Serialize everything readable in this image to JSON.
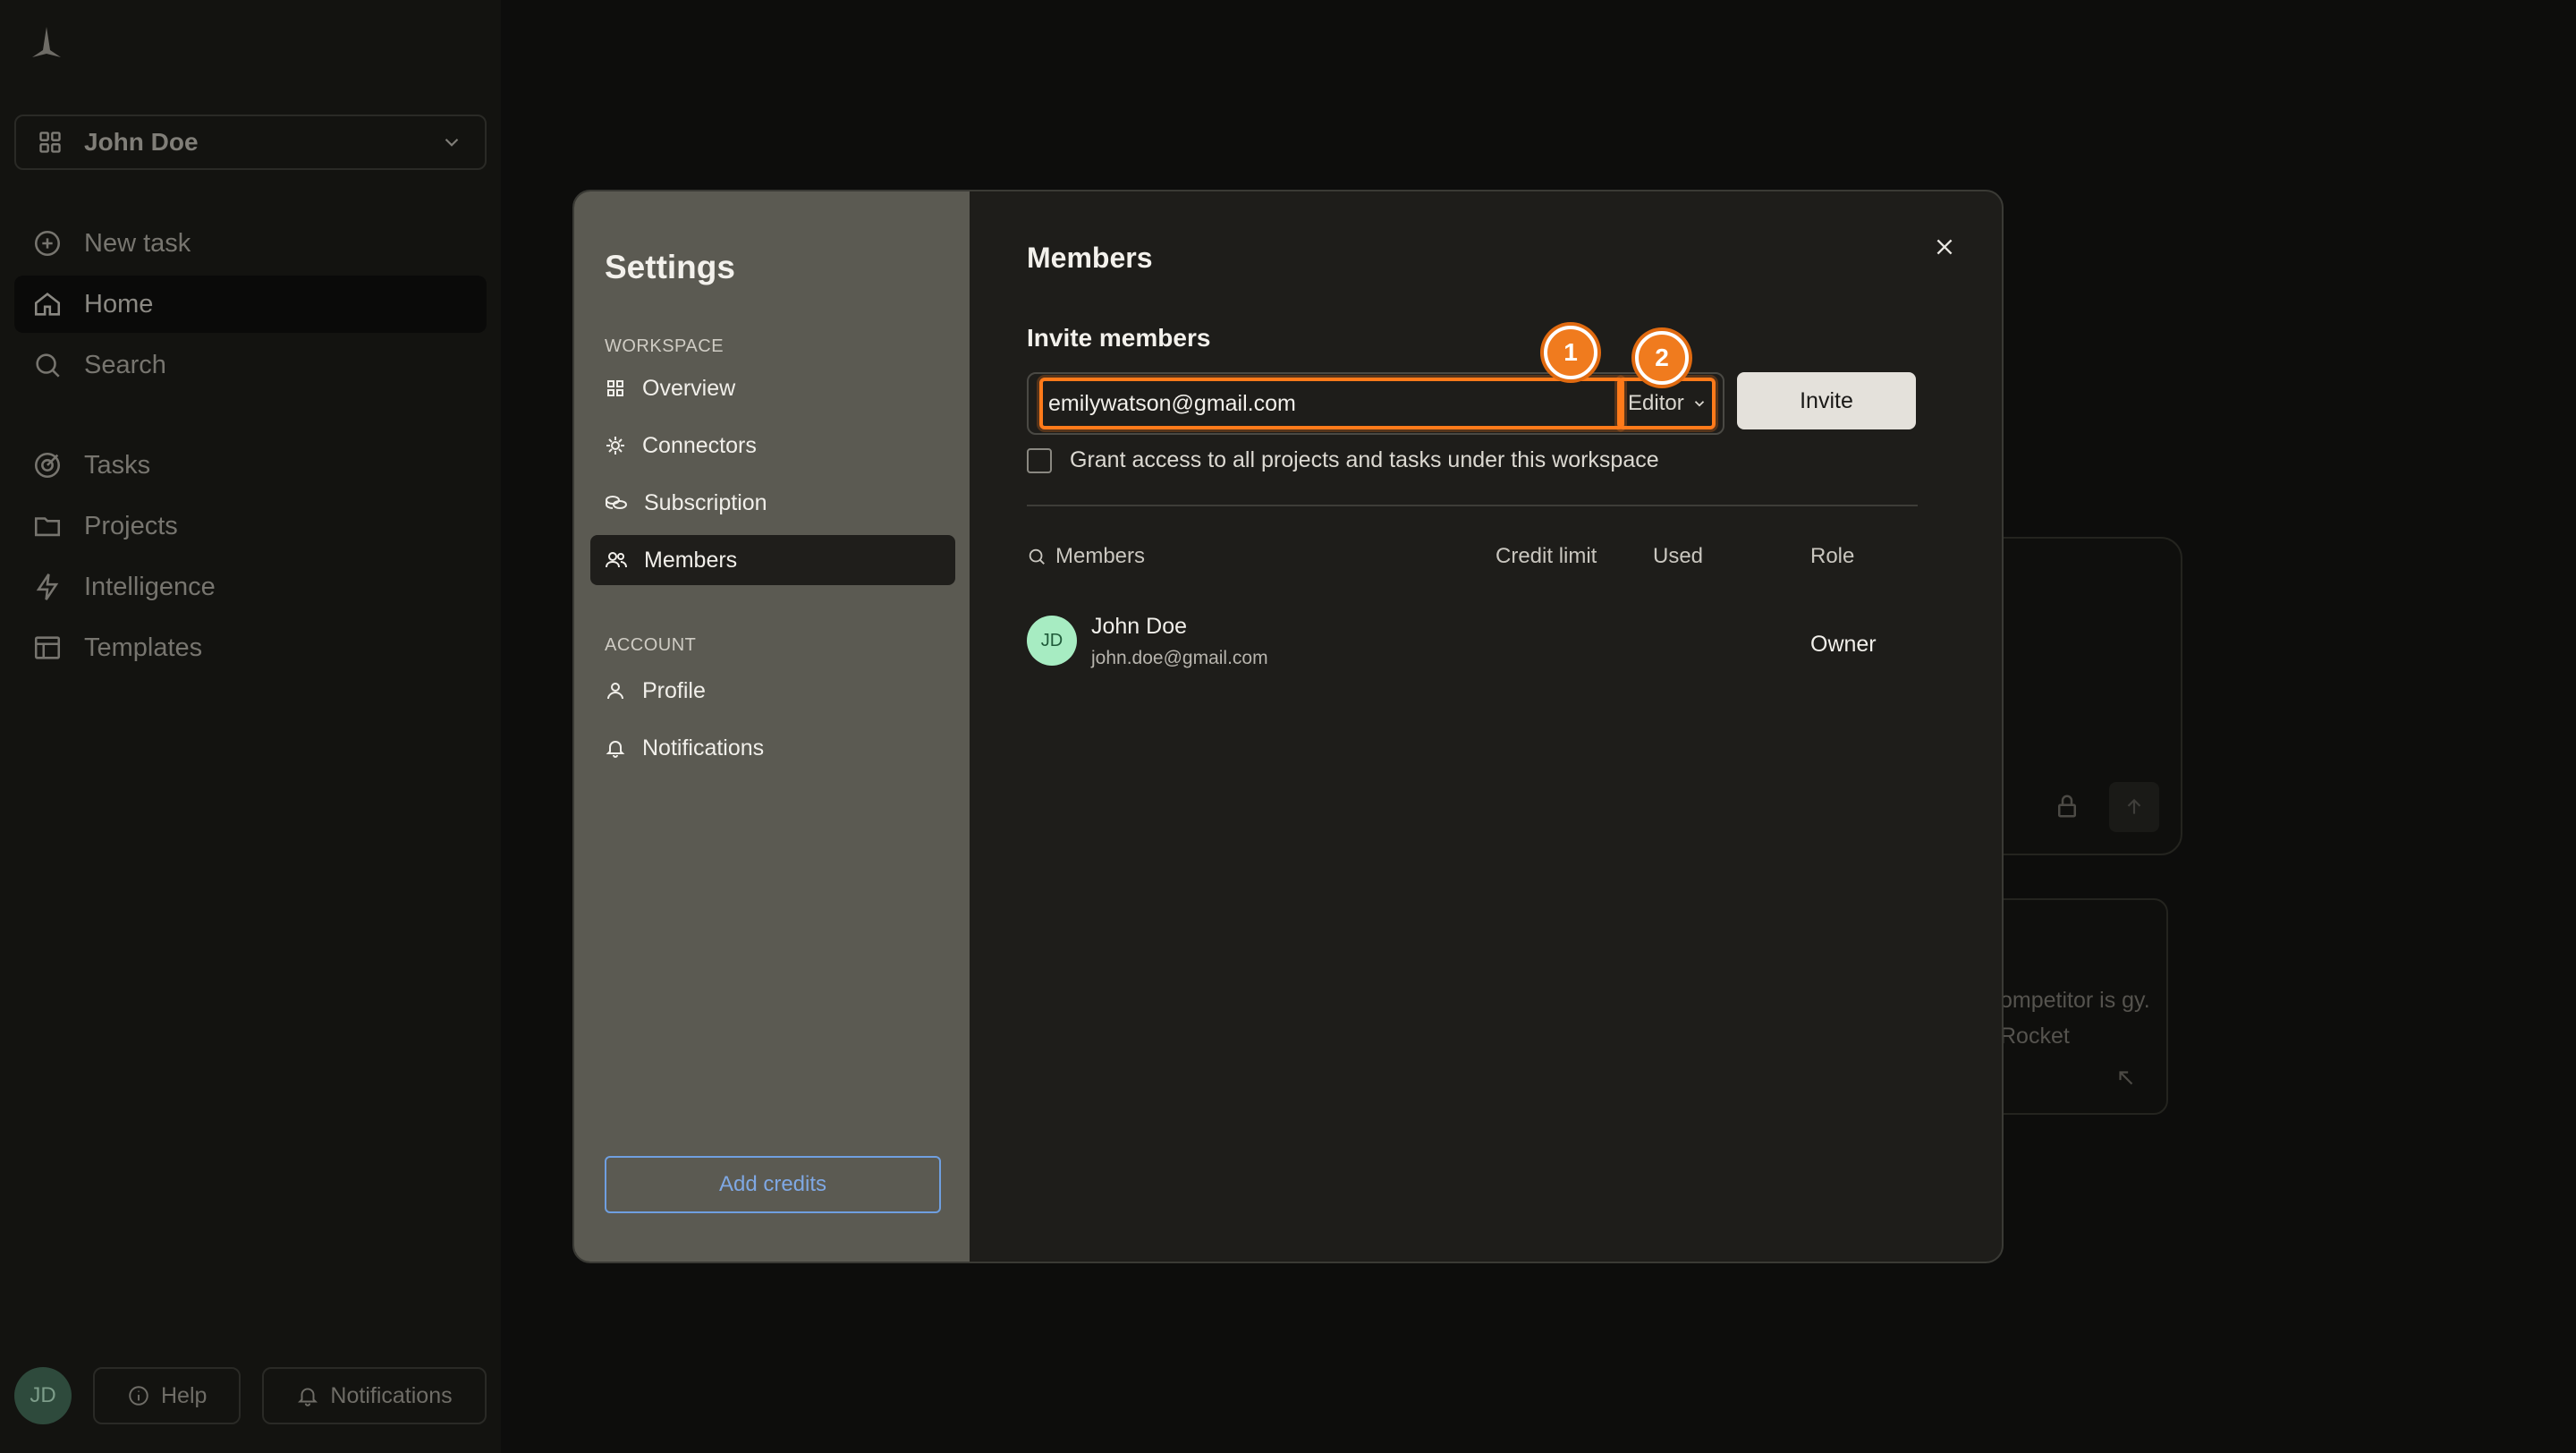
{
  "sidebar": {
    "workspace_name": "John Doe",
    "primary_nav": [
      {
        "label": "New task",
        "icon": "plus-circle-icon"
      },
      {
        "label": "Home",
        "icon": "home-icon",
        "active": true
      },
      {
        "label": "Search",
        "icon": "search-icon"
      }
    ],
    "secondary_nav": [
      {
        "label": "Tasks",
        "icon": "target-icon"
      },
      {
        "label": "Projects",
        "icon": "folder-icon"
      },
      {
        "label": "Intelligence",
        "icon": "lightning-icon"
      },
      {
        "label": "Templates",
        "icon": "template-icon"
      }
    ],
    "user_initials": "JD",
    "help_label": "Help",
    "notifications_label": "Notifications"
  },
  "background": {
    "card_text": "ompetitor is gy. Rocket"
  },
  "settings": {
    "title": "Settings",
    "workspace_section": "WORKSPACE",
    "workspace_items": [
      {
        "label": "Overview",
        "icon": "grid-icon"
      },
      {
        "label": "Connectors",
        "icon": "plug-icon"
      },
      {
        "label": "Subscription",
        "icon": "coins-icon"
      },
      {
        "label": "Members",
        "icon": "users-icon",
        "active": true
      }
    ],
    "account_section": "ACCOUNT",
    "account_items": [
      {
        "label": "Profile",
        "icon": "user-icon"
      },
      {
        "label": "Notifications",
        "icon": "bell-icon"
      }
    ],
    "add_credits_label": "Add credits"
  },
  "members": {
    "title": "Members",
    "invite_heading": "Invite members",
    "email_value": "emilywatson@gmail.com",
    "role_value": "Editor",
    "invite_button": "Invite",
    "grant_access_label": "Grant access to all projects and tasks under this workspace",
    "grant_access_checked": false,
    "annotation_badges": [
      "1",
      "2"
    ],
    "columns": [
      "Members",
      "Credit limit",
      "Used",
      "Role"
    ],
    "rows": [
      {
        "initials": "JD",
        "name": "John Doe",
        "email": "john.doe@gmail.com",
        "credit_limit": "",
        "used": "",
        "role": "Owner"
      }
    ]
  },
  "colors": {
    "highlight": "#ff7a1a",
    "link": "#7fa8e4",
    "avatar": "#a7ecc2"
  }
}
